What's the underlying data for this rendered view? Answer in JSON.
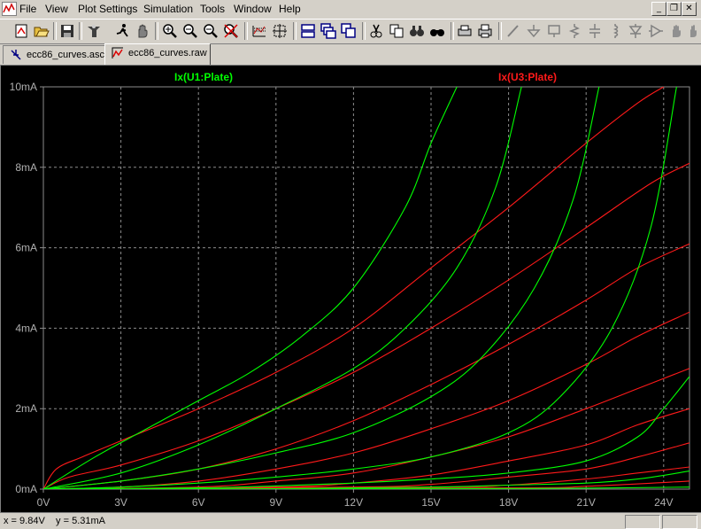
{
  "menu": {
    "items": [
      {
        "label": "File"
      },
      {
        "label": "View"
      },
      {
        "label": "Plot Settings"
      },
      {
        "label": "Simulation"
      },
      {
        "label": "Tools"
      },
      {
        "label": "Window"
      },
      {
        "label": "Help"
      }
    ]
  },
  "window_controls": {
    "minimize": "_",
    "restore": "❐",
    "close": "✕"
  },
  "toolbar": {
    "buttons": [
      "new-schematic-icon",
      "open-icon",
      "save-icon",
      "control-panel-icon",
      "run-icon",
      "halt-icon",
      "zoom-in-icon",
      "zoom-out-icon",
      "zoom-fit-icon",
      "zoom-cancel-icon",
      "autorange-icon",
      "mark-icon",
      "tile-horizontal-icon",
      "cascade-icon",
      "tile-vertical-icon",
      "cut-icon",
      "copy-icon",
      "find-icon",
      "print-preview-icon",
      "print-icon",
      "wire-icon",
      "ground-icon",
      "label-icon",
      "resistor-icon",
      "capacitor-icon",
      "inductor-icon",
      "diode-icon",
      "component-icon",
      "move-icon",
      "drag-icon"
    ]
  },
  "tabs": [
    {
      "label": "ecc86_curves.asc",
      "active": false
    },
    {
      "label": "ecc86_curves.raw",
      "active": true
    }
  ],
  "colors": {
    "green": "#00ff00",
    "red": "#ff1a1a",
    "grid": "#8c8c8c",
    "axis_text": "#b0b0b0",
    "background": "#000000"
  },
  "chart_data": {
    "type": "line",
    "xlabel": "",
    "ylabel": "",
    "xlim": [
      0,
      25
    ],
    "ylim": [
      0,
      10
    ],
    "x_ticks": [
      "0V",
      "3V",
      "6V",
      "9V",
      "12V",
      "15V",
      "18V",
      "21V",
      "24V"
    ],
    "x_tick_values": [
      0,
      3,
      6,
      9,
      12,
      15,
      18,
      21,
      24
    ],
    "y_ticks": [
      "0mA",
      "2mA",
      "4mA",
      "6mA",
      "8mA",
      "10mA"
    ],
    "y_tick_values": [
      0,
      2,
      4,
      6,
      8,
      10
    ],
    "grid": true,
    "legend": [
      {
        "name": "Ix(U1:Plate)",
        "color": "#00ff00"
      },
      {
        "name": "Ix(U3:Plate)",
        "color": "#ff1a1a"
      }
    ],
    "series": [
      {
        "group": "Ix(U1:Plate)",
        "color": "#00ff00",
        "points": [
          [
            0,
            0
          ],
          [
            2,
            0.8
          ],
          [
            4,
            1.5
          ],
          [
            6,
            2.2
          ],
          [
            8,
            2.9
          ],
          [
            10,
            3.8
          ],
          [
            12,
            5.0
          ],
          [
            14,
            7.0
          ],
          [
            15,
            8.6
          ],
          [
            16,
            10
          ]
        ]
      },
      {
        "group": "Ix(U1:Plate)",
        "color": "#00ff00",
        "points": [
          [
            0,
            0
          ],
          [
            3,
            0.4
          ],
          [
            6,
            1.1
          ],
          [
            9,
            2.0
          ],
          [
            12,
            3.0
          ],
          [
            14,
            4.0
          ],
          [
            16,
            5.5
          ],
          [
            17.5,
            7.5
          ],
          [
            18.5,
            10
          ]
        ]
      },
      {
        "group": "Ix(U1:Plate)",
        "color": "#00ff00",
        "points": [
          [
            0,
            0
          ],
          [
            3,
            0.2
          ],
          [
            6,
            0.5
          ],
          [
            9,
            0.9
          ],
          [
            12,
            1.4
          ],
          [
            15,
            2.3
          ],
          [
            17,
            3.3
          ],
          [
            19,
            5.0
          ],
          [
            20.5,
            7.2
          ],
          [
            21.5,
            10
          ]
        ]
      },
      {
        "group": "Ix(U1:Plate)",
        "color": "#00ff00",
        "points": [
          [
            0,
            0
          ],
          [
            3,
            0.05
          ],
          [
            6,
            0.15
          ],
          [
            9,
            0.3
          ],
          [
            12,
            0.5
          ],
          [
            15,
            0.8
          ],
          [
            18,
            1.4
          ],
          [
            20,
            2.3
          ],
          [
            22,
            4.0
          ],
          [
            23.5,
            6.5
          ],
          [
            24.5,
            10
          ]
        ]
      },
      {
        "group": "Ix(U1:Plate)",
        "color": "#00ff00",
        "points": [
          [
            0,
            0
          ],
          [
            6,
            0.03
          ],
          [
            9,
            0.08
          ],
          [
            12,
            0.15
          ],
          [
            15,
            0.25
          ],
          [
            18,
            0.4
          ],
          [
            21,
            0.7
          ],
          [
            23,
            1.3
          ],
          [
            24,
            2.0
          ],
          [
            25,
            2.8
          ]
        ]
      },
      {
        "group": "Ix(U1:Plate)",
        "color": "#00ff00",
        "points": [
          [
            0,
            0
          ],
          [
            9,
            0.01
          ],
          [
            15,
            0.05
          ],
          [
            18,
            0.1
          ],
          [
            21,
            0.15
          ],
          [
            23,
            0.25
          ],
          [
            25,
            0.45
          ]
        ]
      },
      {
        "group": "Ix(U1:Plate)",
        "color": "#00ff00",
        "points": [
          [
            0,
            0
          ],
          [
            15,
            0.01
          ],
          [
            20,
            0.02
          ],
          [
            25,
            0.05
          ]
        ]
      },
      {
        "group": "Ix(U3:Plate)",
        "color": "#ff1a1a",
        "points": [
          [
            0,
            0
          ],
          [
            0.5,
            0.5
          ],
          [
            1.5,
            0.8
          ],
          [
            3,
            1.2
          ],
          [
            6,
            2.0
          ],
          [
            9,
            2.9
          ],
          [
            12,
            4.0
          ],
          [
            15,
            5.5
          ],
          [
            18,
            7.0
          ],
          [
            21,
            8.6
          ],
          [
            23,
            9.6
          ],
          [
            24,
            10
          ]
        ]
      },
      {
        "group": "Ix(U3:Plate)",
        "color": "#ff1a1a",
        "points": [
          [
            0,
            0
          ],
          [
            1,
            0.3
          ],
          [
            3,
            0.6
          ],
          [
            6,
            1.2
          ],
          [
            9,
            2.0
          ],
          [
            12,
            2.9
          ],
          [
            15,
            4.0
          ],
          [
            18,
            5.2
          ],
          [
            21,
            6.5
          ],
          [
            23.5,
            7.6
          ],
          [
            25,
            8.1
          ]
        ]
      },
      {
        "group": "Ix(U3:Plate)",
        "color": "#ff1a1a",
        "points": [
          [
            0,
            0
          ],
          [
            3,
            0.2
          ],
          [
            6,
            0.5
          ],
          [
            9,
            1.0
          ],
          [
            12,
            1.7
          ],
          [
            15,
            2.6
          ],
          [
            18,
            3.6
          ],
          [
            21,
            4.7
          ],
          [
            23,
            5.5
          ],
          [
            25,
            6.1
          ]
        ]
      },
      {
        "group": "Ix(U3:Plate)",
        "color": "#ff1a1a",
        "points": [
          [
            0,
            0
          ],
          [
            3,
            0.05
          ],
          [
            6,
            0.2
          ],
          [
            9,
            0.5
          ],
          [
            12,
            0.9
          ],
          [
            15,
            1.5
          ],
          [
            18,
            2.2
          ],
          [
            21,
            3.1
          ],
          [
            23,
            3.8
          ],
          [
            25,
            4.4
          ]
        ]
      },
      {
        "group": "Ix(U3:Plate)",
        "color": "#ff1a1a",
        "points": [
          [
            0,
            0
          ],
          [
            6,
            0.05
          ],
          [
            9,
            0.2
          ],
          [
            12,
            0.4
          ],
          [
            15,
            0.8
          ],
          [
            18,
            1.3
          ],
          [
            21,
            2.0
          ],
          [
            23,
            2.5
          ],
          [
            25,
            3.0
          ]
        ]
      },
      {
        "group": "Ix(U3:Plate)",
        "color": "#ff1a1a",
        "points": [
          [
            0,
            0
          ],
          [
            9,
            0.05
          ],
          [
            12,
            0.15
          ],
          [
            15,
            0.35
          ],
          [
            18,
            0.7
          ],
          [
            21,
            1.1
          ],
          [
            23,
            1.6
          ],
          [
            25,
            2.0
          ]
        ]
      },
      {
        "group": "Ix(U3:Plate)",
        "color": "#ff1a1a",
        "points": [
          [
            0,
            0
          ],
          [
            12,
            0.05
          ],
          [
            15,
            0.12
          ],
          [
            18,
            0.3
          ],
          [
            21,
            0.5
          ],
          [
            23,
            0.8
          ],
          [
            25,
            1.15
          ]
        ]
      },
      {
        "group": "Ix(U3:Plate)",
        "color": "#ff1a1a",
        "points": [
          [
            0,
            0
          ],
          [
            15,
            0.05
          ],
          [
            18,
            0.1
          ],
          [
            21,
            0.25
          ],
          [
            23,
            0.4
          ],
          [
            25,
            0.55
          ]
        ]
      },
      {
        "group": "Ix(U3:Plate)",
        "color": "#ff1a1a",
        "points": [
          [
            0,
            0
          ],
          [
            18,
            0.03
          ],
          [
            21,
            0.07
          ],
          [
            25,
            0.2
          ]
        ]
      }
    ]
  },
  "status": {
    "x_label": "x =",
    "x_value": "9.84V",
    "y_label": "y =",
    "y_value": "5.31mA"
  }
}
